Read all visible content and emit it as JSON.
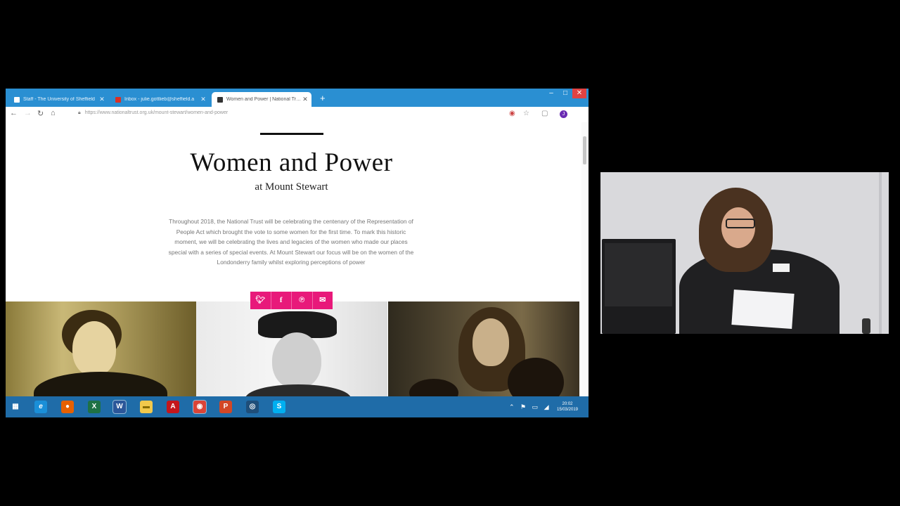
{
  "browser": {
    "tabs": [
      {
        "title": "Staff - The University of Sheffield",
        "active": false,
        "favicon_color": "#ffffff"
      },
      {
        "title": "Inbox - julie.gottlieb@sheffield.a",
        "active": false,
        "favicon_color": "#d93025"
      },
      {
        "title": "Women and Power | National Trust",
        "active": true,
        "favicon_color": "#333333"
      }
    ],
    "new_tab": "+",
    "window_buttons": {
      "minimize": "–",
      "maximize": "□",
      "close": "✕"
    },
    "url": "https://www.nationaltrust.org.uk/mount-stewart/women-and-power",
    "profile_initial": "J"
  },
  "page": {
    "title": "Women and Power",
    "subtitle": "at Mount Stewart",
    "intro": "Throughout 2018, the National Trust will be celebrating the centenary of the Representation of People Act which brought the vote to some women for the first time. To mark this historic moment, we will be celebrating the lives and legacies of the women who made our places special with a series of special events. At Mount Stewart our focus will be on the women of the Londonderry family whilst exploring perceptions of power",
    "share_icons": [
      "twitter-icon",
      "facebook-icon",
      "pinterest-icon",
      "email-icon"
    ],
    "share_color": "#e8197a"
  },
  "taskbar": {
    "apps": [
      {
        "name": "task-view",
        "glyph": "▦",
        "color": "#1f6ca8"
      },
      {
        "name": "internet-explorer",
        "glyph": "e",
        "color": "#1a8fd8"
      },
      {
        "name": "firefox",
        "glyph": "●",
        "color": "#e66000"
      },
      {
        "name": "excel",
        "glyph": "X",
        "color": "#1e7145"
      },
      {
        "name": "word",
        "glyph": "W",
        "color": "#2b579a"
      },
      {
        "name": "file-explorer",
        "glyph": "▬",
        "color": "#f2c94c"
      },
      {
        "name": "acrobat",
        "glyph": "A",
        "color": "#c4161c"
      },
      {
        "name": "chrome",
        "glyph": "◉",
        "color": "#db4437"
      },
      {
        "name": "powerpoint",
        "glyph": "P",
        "color": "#d24726"
      },
      {
        "name": "eye-app",
        "glyph": "◎",
        "color": "#1f4e79"
      },
      {
        "name": "skype",
        "glyph": "S",
        "color": "#00aff0"
      }
    ],
    "tray": "⌃ ⚑ ▭ ◢",
    "time": "20:02",
    "date": "15/03/2019"
  }
}
